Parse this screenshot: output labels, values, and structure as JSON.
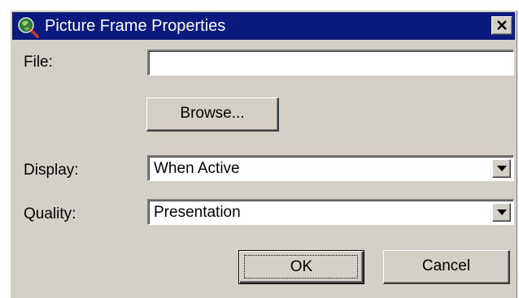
{
  "window": {
    "title": "Picture Frame Properties",
    "title_bar_color": "#0b1a7e",
    "app_icon": "picture-frame-icon",
    "close_icon": "close-icon"
  },
  "form": {
    "file_label": "File:",
    "file_value": "",
    "browse_label": "Browse...",
    "display_label": "Display:",
    "display_value": "When Active",
    "quality_label": "Quality:",
    "quality_value": "Presentation"
  },
  "buttons": {
    "ok_label": "OK",
    "cancel_label": "Cancel"
  }
}
